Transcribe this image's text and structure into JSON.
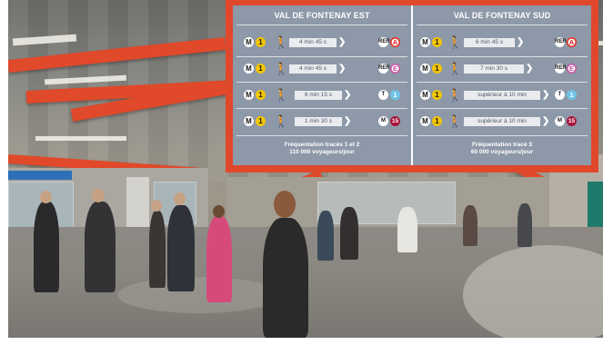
{
  "columns": [
    {
      "title": "VAL DE FONTENAY EST",
      "rows": [
        {
          "metro": "M",
          "line": "1",
          "walk": "🚶",
          "time": "4 min 45 s",
          "mode": "RER",
          "dest": "A",
          "dest_color": "#e2231a"
        },
        {
          "metro": "M",
          "line": "1",
          "walk": "🚶",
          "time": "4 min 45 s",
          "mode": "RER",
          "dest": "E",
          "dest_color": "#c04a9c"
        },
        {
          "metro": "M",
          "line": "1",
          "walk": "🚶",
          "time": "6 min 15 s",
          "mode": "T",
          "dest": "1",
          "dest_color": "#6ec4e8"
        },
        {
          "metro": "M",
          "line": "1",
          "walk": "🚶",
          "time": "1 min 30 s",
          "mode": "M",
          "dest": "15",
          "dest_color": "#a8143a"
        }
      ],
      "footer": [
        "Fréquentation tracés 1 et 2",
        "110 000 voyageurs/jour"
      ]
    },
    {
      "title": "VAL DE FONTENAY SUD",
      "rows": [
        {
          "metro": "M",
          "line": "1",
          "walk": "🚶",
          "time": "6 min 45 s",
          "mode": "RER",
          "dest": "A",
          "dest_color": "#e2231a"
        },
        {
          "metro": "M",
          "line": "1",
          "walk": "🚶",
          "time": "7 min 30 s",
          "mode": "RER",
          "dest": "E",
          "dest_color": "#c04a9c"
        },
        {
          "metro": "M",
          "line": "1",
          "walk": "🚶",
          "time": "supérieur à 10 min",
          "mode": "T",
          "dest": "1",
          "dest_color": "#6ec4e8"
        },
        {
          "metro": "M",
          "line": "1",
          "walk": "🚶",
          "time": "supérieur à 10 min",
          "mode": "M",
          "dest": "15",
          "dest_color": "#a8143a"
        }
      ],
      "footer": [
        "Fréquentation tracé 3",
        "60 000 voyageurs/jour"
      ]
    }
  ],
  "colors": {
    "panel_border": "#e0482b",
    "panel_bg": "#8d98a8",
    "metro_line_1": "#f2c500"
  },
  "icons": {
    "walk": "pedestrian-icon",
    "arrow": "chevron-right-icon"
  }
}
